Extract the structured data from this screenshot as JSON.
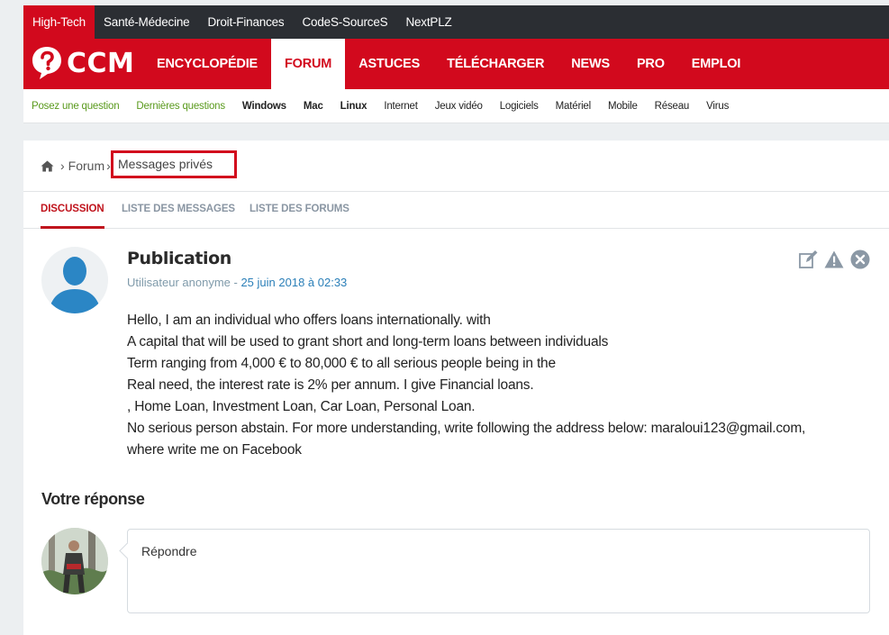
{
  "network": {
    "sites": [
      "High-Tech",
      "Santé-Médecine",
      "Droit-Finances",
      "CodeS-SourceS",
      "NextPLZ"
    ]
  },
  "brand": {
    "logo_text": "CCM",
    "accent": "#d2091d"
  },
  "main_nav": [
    "ENCYCLOPÉDIE",
    "FORUM",
    "ASTUCES",
    "TÉLÉCHARGER",
    "NEWS",
    "PRO",
    "EMPLOI"
  ],
  "sub_nav": [
    "Posez une question",
    "Dernières questions",
    "Windows",
    "Mac",
    "Linux",
    "Internet",
    "Jeux vidéo",
    "Logiciels",
    "Matériel",
    "Mobile",
    "Réseau",
    "Virus"
  ],
  "breadcrumb": {
    "forum": "Forum",
    "current": "Messages privés"
  },
  "tabs": [
    "DISCUSSION",
    "LISTE DES MESSAGES",
    "LISTE DES FORUMS"
  ],
  "post": {
    "title": "Publication",
    "author": "Utilisateur anonyme",
    "separator": " - ",
    "date": "25 juin 2018 à 02:33",
    "lines": [
      "Hello, I am an individual who offers loans internationally. with",
      "A capital that will be used to grant short and long-term loans between individuals",
      "Term ranging from 4,000 € to 80,000 € to all serious people being in the",
      "Real need, the interest rate is 2% per annum. I give Financial loans.",
      ", Home Loan, Investment Loan, Car Loan, Personal Loan.",
      "No serious person abstain. For more understanding, write following the address below: maraloui123@gmail.com,",
      "where write me on Facebook"
    ]
  },
  "reply": {
    "heading": "Votre réponse",
    "placeholder": "Répondre"
  }
}
